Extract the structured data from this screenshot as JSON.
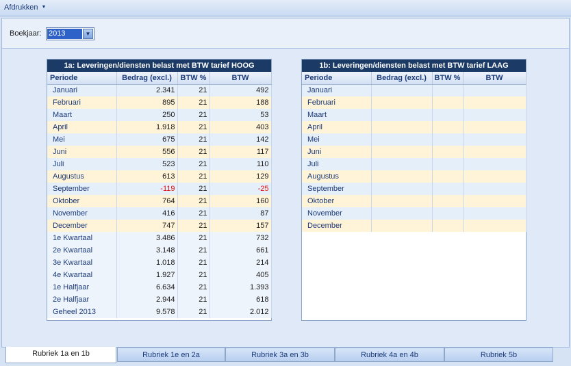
{
  "menu": {
    "print_label": "Afdrukken"
  },
  "filter": {
    "year_label": "Boekjaar:",
    "year_value": "2013"
  },
  "table_high": {
    "title": "1a: Leveringen/diensten belast met BTW tarief HOOG",
    "headers": [
      "Periode",
      "Bedrag (excl.)",
      "BTW %",
      "BTW"
    ],
    "rows": [
      [
        "Januari",
        "2.341",
        "21",
        "492"
      ],
      [
        "Februari",
        "895",
        "21",
        "188"
      ],
      [
        "Maart",
        "250",
        "21",
        "53"
      ],
      [
        "April",
        "1.918",
        "21",
        "403"
      ],
      [
        "Mei",
        "675",
        "21",
        "142"
      ],
      [
        "Juni",
        "556",
        "21",
        "117"
      ],
      [
        "Juli",
        "523",
        "21",
        "110"
      ],
      [
        "Augustus",
        "613",
        "21",
        "129"
      ],
      [
        "September",
        "-119",
        "21",
        "-25"
      ],
      [
        "Oktober",
        "764",
        "21",
        "160"
      ],
      [
        "November",
        "416",
        "21",
        "87"
      ],
      [
        "December",
        "747",
        "21",
        "157"
      ],
      [
        "1e Kwartaal",
        "3.486",
        "21",
        "732"
      ],
      [
        "2e Kwartaal",
        "3.148",
        "21",
        "661"
      ],
      [
        "3e Kwartaal",
        "1.018",
        "21",
        "214"
      ],
      [
        "4e Kwartaal",
        "1.927",
        "21",
        "405"
      ],
      [
        "1e Halfjaar",
        "6.634",
        "21",
        "1.393"
      ],
      [
        "2e Halfjaar",
        "2.944",
        "21",
        "618"
      ],
      [
        "Geheel 2013",
        "9.578",
        "21",
        "2.012"
      ]
    ]
  },
  "table_low": {
    "title": "1b: Leveringen/diensten belast met BTW tarief LAAG",
    "headers": [
      "Periode",
      "Bedrag (excl.)",
      "BTW %",
      "BTW"
    ],
    "rows": [
      [
        "Januari",
        "",
        "",
        ""
      ],
      [
        "Februari",
        "",
        "",
        ""
      ],
      [
        "Maart",
        "",
        "",
        ""
      ],
      [
        "April",
        "",
        "",
        ""
      ],
      [
        "Mei",
        "",
        "",
        ""
      ],
      [
        "Juni",
        "",
        "",
        ""
      ],
      [
        "Juli",
        "",
        "",
        ""
      ],
      [
        "Augustus",
        "",
        "",
        ""
      ],
      [
        "September",
        "",
        "",
        ""
      ],
      [
        "Oktober",
        "",
        "",
        ""
      ],
      [
        "November",
        "",
        "",
        ""
      ],
      [
        "December",
        "",
        "",
        ""
      ]
    ]
  },
  "tabs": [
    {
      "label": "Rubriek 1a en 1b",
      "active": true
    },
    {
      "label": "Rubriek 1e en 2a",
      "active": false
    },
    {
      "label": "Rubriek 3a en 3b",
      "active": false
    },
    {
      "label": "Rubriek 4a en 4b",
      "active": false
    },
    {
      "label": "Rubriek 5b",
      "active": false
    }
  ],
  "colors": {
    "title_bg": "#1b3a66",
    "negative": "#e01010",
    "row_odd": "#e5effa",
    "row_even": "#fff3d8"
  }
}
